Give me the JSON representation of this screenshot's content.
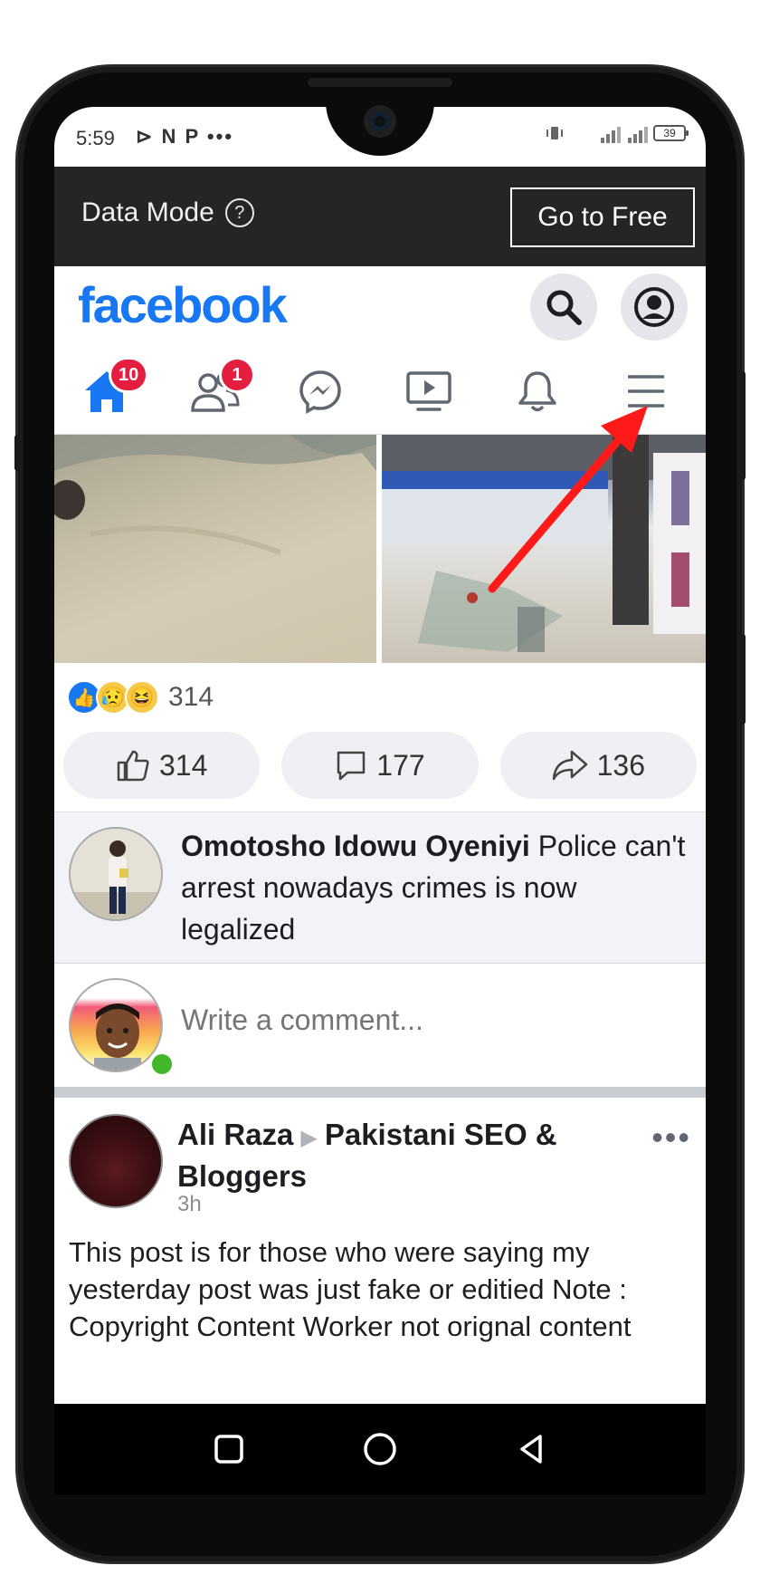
{
  "status_bar": {
    "time": "5:59",
    "left_icons": "⊳ N P •••",
    "battery": "39"
  },
  "data_mode": {
    "label": "Data Mode",
    "help_glyph": "?",
    "go_free_label": "Go to Free"
  },
  "header": {
    "logo": "facebook",
    "brand_color": "#1877f2"
  },
  "nav": {
    "home_badge": "10",
    "friends_badge": "1",
    "items": [
      "home-icon",
      "friends-icon",
      "messenger-icon",
      "watch-icon",
      "notifications-icon",
      "menu-icon"
    ]
  },
  "reactions": {
    "emojis": [
      "like",
      "sad",
      "haha"
    ],
    "count": "314"
  },
  "actions": {
    "like_count": "314",
    "comment_count": "177",
    "share_count": "136"
  },
  "comment": {
    "author": "Omotosho Idowu Oyeniyi",
    "text": " Police can't arrest nowadays crimes is now legalized"
  },
  "write_comment": {
    "placeholder": "Write a comment..."
  },
  "post": {
    "author": "Ali Raza",
    "group": "Pakistani SEO & Bloggers",
    "time": "3h",
    "more": "•••",
    "body": "This post is for those who were saying my yesterday post was just fake or editied Note : Copyright Content Worker not orignal content"
  },
  "annotation": {
    "arrow_color": "#ff1a1a"
  }
}
